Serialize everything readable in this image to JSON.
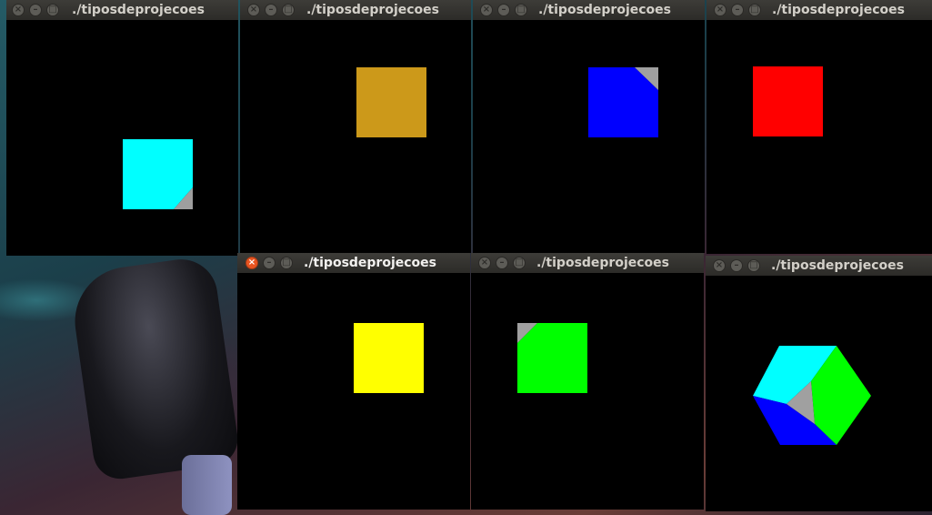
{
  "desktop": {
    "wallpaper_icon": "fantasy-artwork"
  },
  "windows": [
    {
      "title": "./tiposdeprojecoes",
      "active": false,
      "shape": "square",
      "color": "#00ffff",
      "corner": "bottom-right",
      "accent": "#9e9e9e"
    },
    {
      "title": "./tiposdeprojecoes",
      "active": false,
      "shape": "square",
      "color": "#cc991a",
      "corner": "none"
    },
    {
      "title": "./tiposdeprojecoes",
      "active": false,
      "shape": "square",
      "color": "#0000ff",
      "corner": "top-right",
      "accent": "#a0a0a0"
    },
    {
      "title": "./tiposdeprojecoes",
      "active": false,
      "shape": "square",
      "color": "#ff0000",
      "corner": "none"
    },
    {
      "title": "./tiposdeprojecoes",
      "active": true,
      "shape": "square",
      "color": "#ffff00",
      "corner": "none"
    },
    {
      "title": "./tiposdeprojecoes",
      "active": false,
      "shape": "square",
      "color": "#00ff00",
      "corner": "top-left",
      "accent": "#a0a0a0"
    },
    {
      "title": "./tiposdeprojecoes",
      "active": false,
      "shape": "isometric-cube",
      "colors": [
        "#00ffff",
        "#00ff00",
        "#0000ff",
        "#a0a0a0"
      ]
    }
  ],
  "window_controls": {
    "close_icon": "close-icon",
    "minimize_icon": "minimize-icon",
    "maximize_icon": "maximize-icon"
  }
}
